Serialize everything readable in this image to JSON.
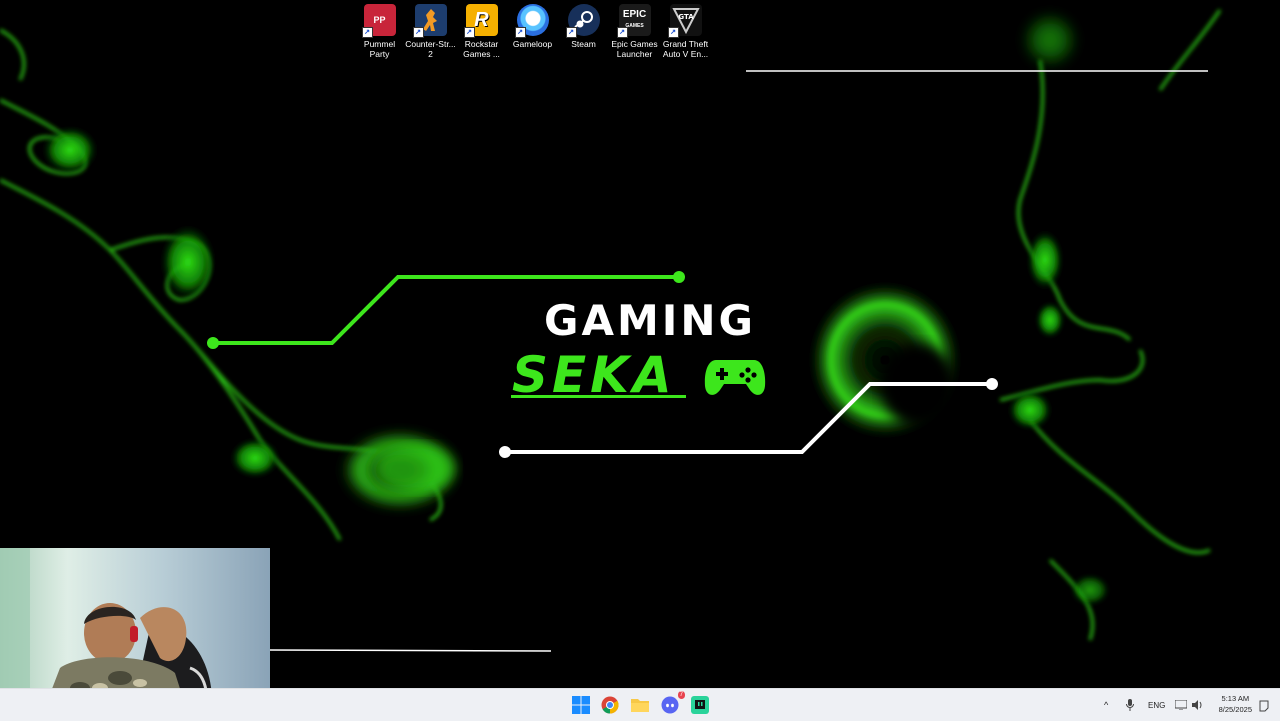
{
  "desktop_icons": [
    {
      "label": "Pummel\nParty",
      "icon": "pummel-party-icon",
      "color": "#c8253a"
    },
    {
      "label": "Counter-Str...\n2",
      "icon": "counter-strike-icon",
      "color": "#1d3d6e"
    },
    {
      "label": "Rockstar\nGames ...",
      "icon": "rockstar-icon",
      "color": "#f5b000"
    },
    {
      "label": "Gameloop",
      "icon": "gameloop-icon",
      "color": "#2fa9f5"
    },
    {
      "label": "Steam",
      "icon": "steam-icon",
      "color": "#17305a"
    },
    {
      "label": "Epic Games\nLauncher",
      "icon": "epic-games-icon",
      "color": "#1a1a1a"
    },
    {
      "label": "Grand Theft\nAuto V En...",
      "icon": "gta-v-icon",
      "color": "#111111"
    }
  ],
  "wallpaper": {
    "line1": "GAMING",
    "line2": "SEKA",
    "accent": "#3de61c"
  },
  "taskbar": {
    "apps": [
      {
        "name": "start-button",
        "icon": "windows-icon"
      },
      {
        "name": "chrome",
        "icon": "chrome-icon"
      },
      {
        "name": "file-explorer",
        "icon": "folder-icon"
      },
      {
        "name": "discord",
        "icon": "discord-icon",
        "badge": "7"
      },
      {
        "name": "twitch-studio",
        "icon": "twitch-icon"
      }
    ],
    "tray": {
      "language": "ENG",
      "time": "5:13 AM",
      "date": "8/25/2025"
    }
  }
}
